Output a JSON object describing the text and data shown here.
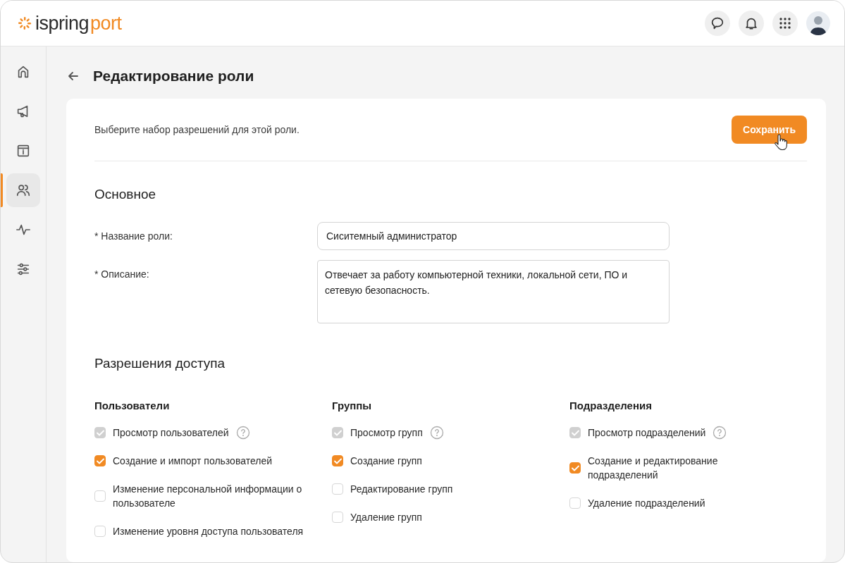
{
  "header": {
    "logo": {
      "text": "ispring",
      "accent": "port"
    },
    "actions": [
      {
        "kind": "chat"
      },
      {
        "kind": "bell"
      },
      {
        "kind": "apps"
      }
    ]
  },
  "sidebar": {
    "items": [
      {
        "kind": "home",
        "selected": false
      },
      {
        "kind": "megaphone",
        "selected": false
      },
      {
        "kind": "info",
        "selected": false
      },
      {
        "kind": "users",
        "selected": true
      },
      {
        "kind": "pulse",
        "selected": false
      },
      {
        "kind": "sliders",
        "selected": false
      }
    ]
  },
  "page": {
    "title": "Редактирование роли"
  },
  "card": {
    "hint": "Выберите набор разрешений для этой роли.",
    "save_button": "Сохранить",
    "basic": {
      "heading": "Основное",
      "fields": [
        {
          "kind": "input",
          "label": "* Название роли:",
          "value": "Сиситемный администратор"
        },
        {
          "kind": "textarea",
          "label": "* Описание:",
          "value": "Отвечает за работу компьютерной техники, локальной сети, ПО и сетевую безопасность."
        }
      ]
    },
    "permissions": {
      "heading": "Разрешения доступа",
      "groups": [
        {
          "title": "Пользователи",
          "items": [
            {
              "label": "Просмотр пользователей",
              "checked": true,
              "disabled": true,
              "help": true
            },
            {
              "label": "Создание и импорт пользователей",
              "checked": true,
              "disabled": false,
              "help": false
            },
            {
              "label": "Изменение персональной информации о пользователе",
              "checked": false,
              "disabled": false,
              "help": false
            },
            {
              "label": "Изменение уровня доступа пользователя",
              "checked": false,
              "disabled": false,
              "help": false
            }
          ]
        },
        {
          "title": "Группы",
          "items": [
            {
              "label": "Просмотр групп",
              "checked": true,
              "disabled": true,
              "help": true
            },
            {
              "label": "Создание групп",
              "checked": true,
              "disabled": false,
              "help": false
            },
            {
              "label": "Редактирование групп",
              "checked": false,
              "disabled": false,
              "help": false
            },
            {
              "label": "Удаление групп",
              "checked": false,
              "disabled": false,
              "help": false
            }
          ]
        },
        {
          "title": "Подразделения",
          "items": [
            {
              "label": "Просмотр подразделений",
              "checked": true,
              "disabled": true,
              "help": true
            },
            {
              "label": "Создание и редактирование подразделений",
              "checked": true,
              "disabled": false,
              "help": false
            },
            {
              "label": "Удаление подразделений",
              "checked": false,
              "disabled": false,
              "help": false
            }
          ]
        }
      ]
    }
  }
}
